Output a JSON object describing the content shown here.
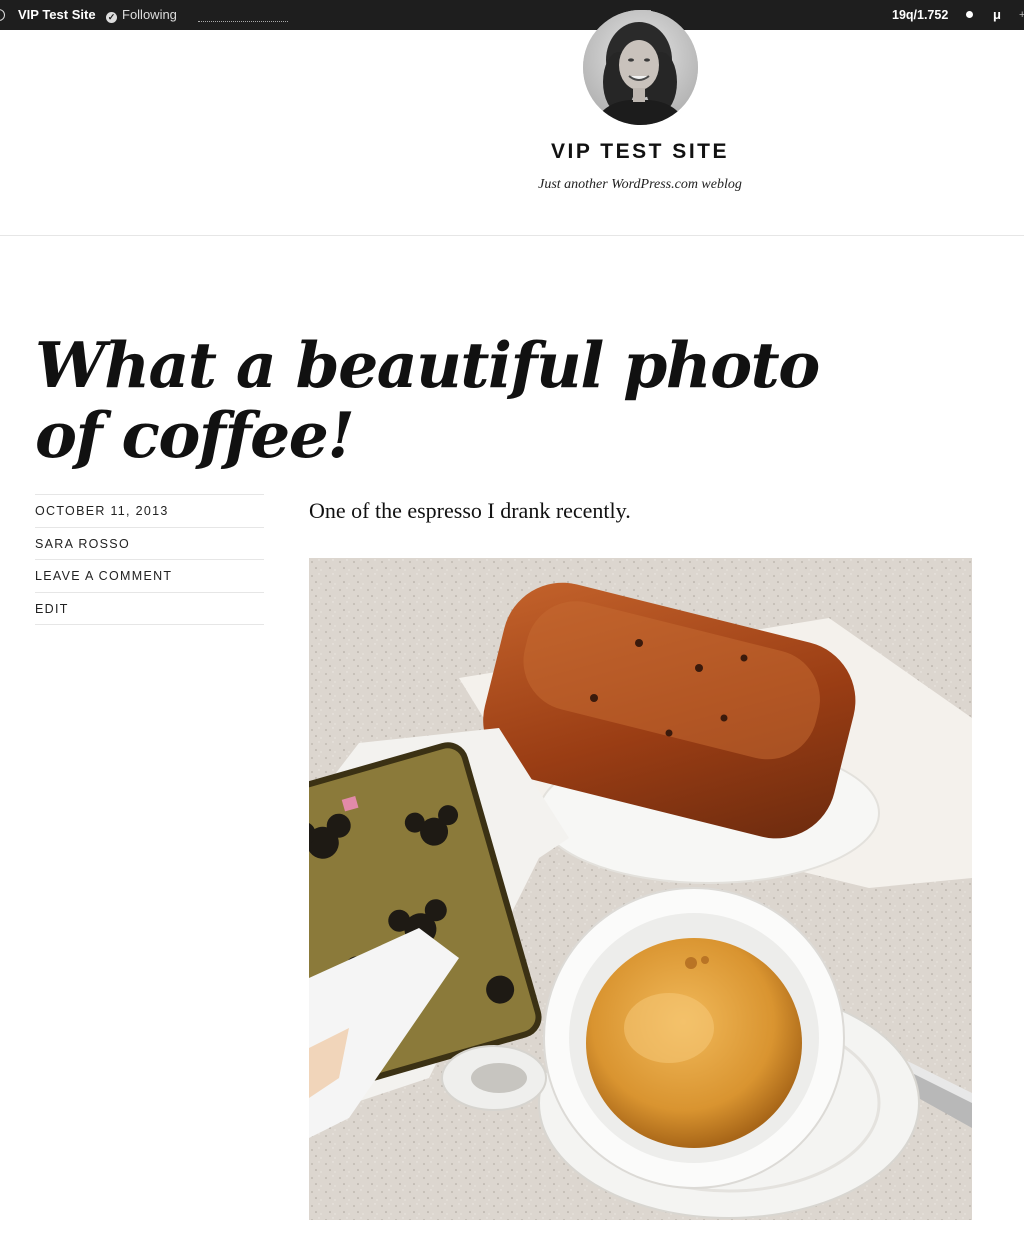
{
  "adminbar": {
    "site_name": "VIP Test Site",
    "following_label": "Following",
    "stats": "19q/1.752",
    "mu_label": "μ",
    "extra_label": "+",
    "icons": {
      "following": "check-circle-icon",
      "collapse": "collapse-arrow-icon",
      "edge": "wordpress-logo-icon",
      "dot": "notification-dot-icon"
    }
  },
  "header": {
    "site_title": "VIP TEST SITE",
    "tagline": "Just another WordPress.com weblog"
  },
  "post": {
    "title": "What a beautiful photo of coffee!",
    "meta": {
      "date": "OCTOBER 11, 2013",
      "author": "SARA ROSSO",
      "comments": "LEAVE A COMMENT",
      "edit": "EDIT"
    },
    "excerpt": "One of the espresso I drank recently."
  }
}
